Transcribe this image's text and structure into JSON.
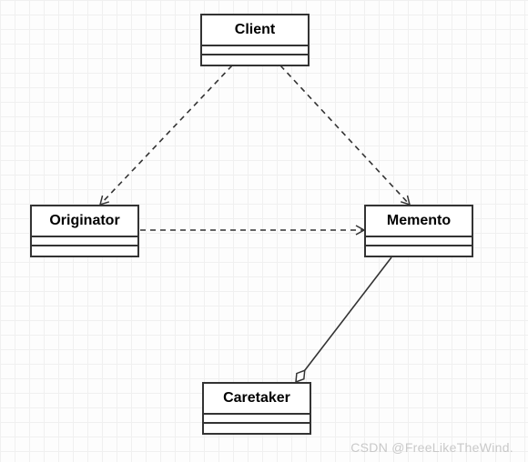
{
  "diagram": {
    "classes": {
      "client": {
        "name": "Client"
      },
      "originator": {
        "name": "Originator"
      },
      "memento": {
        "name": "Memento"
      },
      "caretaker": {
        "name": "Caretaker"
      }
    },
    "relations": [
      {
        "from": "client",
        "to": "originator",
        "style": "dashed-arrow"
      },
      {
        "from": "client",
        "to": "memento",
        "style": "dashed-arrow"
      },
      {
        "from": "originator",
        "to": "memento",
        "style": "dashed-arrow"
      },
      {
        "from": "caretaker",
        "to": "memento",
        "style": "aggregation"
      }
    ]
  },
  "watermark": "CSDN @FreeLikeTheWind."
}
